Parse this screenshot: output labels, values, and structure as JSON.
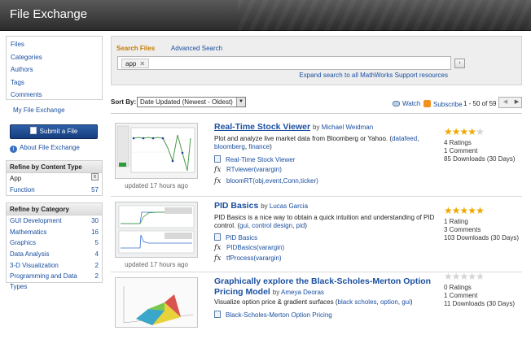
{
  "window": {
    "title": "File Exchange"
  },
  "sidebar": {
    "nav": [
      "Files",
      "Categories",
      "Authors",
      "Tags",
      "Comments"
    ],
    "my_file_exchange": "My File Exchange",
    "submit_label": "Submit a File",
    "about_label": "About File Exchange",
    "refine_content": {
      "title": "Refine by Content Type",
      "rows": [
        {
          "label": "App",
          "value": "x"
        },
        {
          "label": "Function",
          "value": "57"
        }
      ]
    },
    "refine_category": {
      "title": "Refine by Category",
      "rows": [
        {
          "label": "GUI Development",
          "value": "30"
        },
        {
          "label": "Mathematics",
          "value": "16"
        },
        {
          "label": "Graphics",
          "value": "5"
        },
        {
          "label": "Data Analysis",
          "value": "4"
        },
        {
          "label": "3-D Visualization",
          "value": "2"
        },
        {
          "label": "Programming and Data Types",
          "value": "2"
        }
      ]
    }
  },
  "search": {
    "tab_search": "Search Files",
    "tab_advanced": "Advanced Search",
    "token": "app",
    "token_close": "✕",
    "go": "›",
    "expand_link": "Expand search to all MathWorks Support resources"
  },
  "sort": {
    "label": "Sort By:",
    "selected": "Date Updated (Newest - Oldest)",
    "watch": "Watch",
    "subscribe": "Subscribe",
    "count": "1 - 50 of 59"
  },
  "results": [
    {
      "title": "Real-Time Stock Viewer",
      "by": "by",
      "author": "Michael Weidman",
      "desc_text": "Plot and analyze live market data from Bloomberg or Yahoo. (",
      "tags": [
        "datafeed",
        "bloomberg",
        "finance"
      ],
      "files": [
        {
          "type": "doc",
          "name": "Real-Time Stock Viewer"
        },
        {
          "type": "fx",
          "name": "RTviewer(varargin)"
        },
        {
          "type": "fx",
          "name": "bloomRT(obj,event,Conn,ticker)"
        }
      ],
      "updated": "updated 17 hours ago",
      "rating": 4,
      "ratings": "4 Ratings",
      "comments": "1 Comment",
      "downloads": "85 Downloads (30 Days)"
    },
    {
      "title": "PID Basics",
      "by": "by",
      "author": "Lucas Garcia",
      "desc_text": "PID Basics is a nice way to obtain a quick intuition and understanding of PID control. (",
      "tags": [
        "gui",
        "control design",
        "pid"
      ],
      "files": [
        {
          "type": "doc",
          "name": "PID Basics"
        },
        {
          "type": "fx",
          "name": "PIDBasics(varargin)"
        },
        {
          "type": "fx",
          "name": "tfProcess(varargin)"
        }
      ],
      "updated": "updated 17 hours ago",
      "rating": 5,
      "ratings": "1 Rating",
      "comments": "3 Comments",
      "downloads": "103 Downloads (30 Days)"
    },
    {
      "title_line1": "Graphically explore the Black-Scholes-Merton Option",
      "title_line2": "Pricing Model",
      "by": "by",
      "author": "Ameya Deoras",
      "desc_text": "Visualize option price & gradient surfaces (",
      "tags": [
        "black scholes",
        "option",
        "gui"
      ],
      "files": [
        {
          "type": "doc",
          "name": "Black-Scholes-Merton Option Pricing"
        }
      ],
      "rating": 0,
      "ratings": "0 Ratings",
      "comments": "1 Comment",
      "downloads": "11 Downloads (30 Days)"
    }
  ]
}
